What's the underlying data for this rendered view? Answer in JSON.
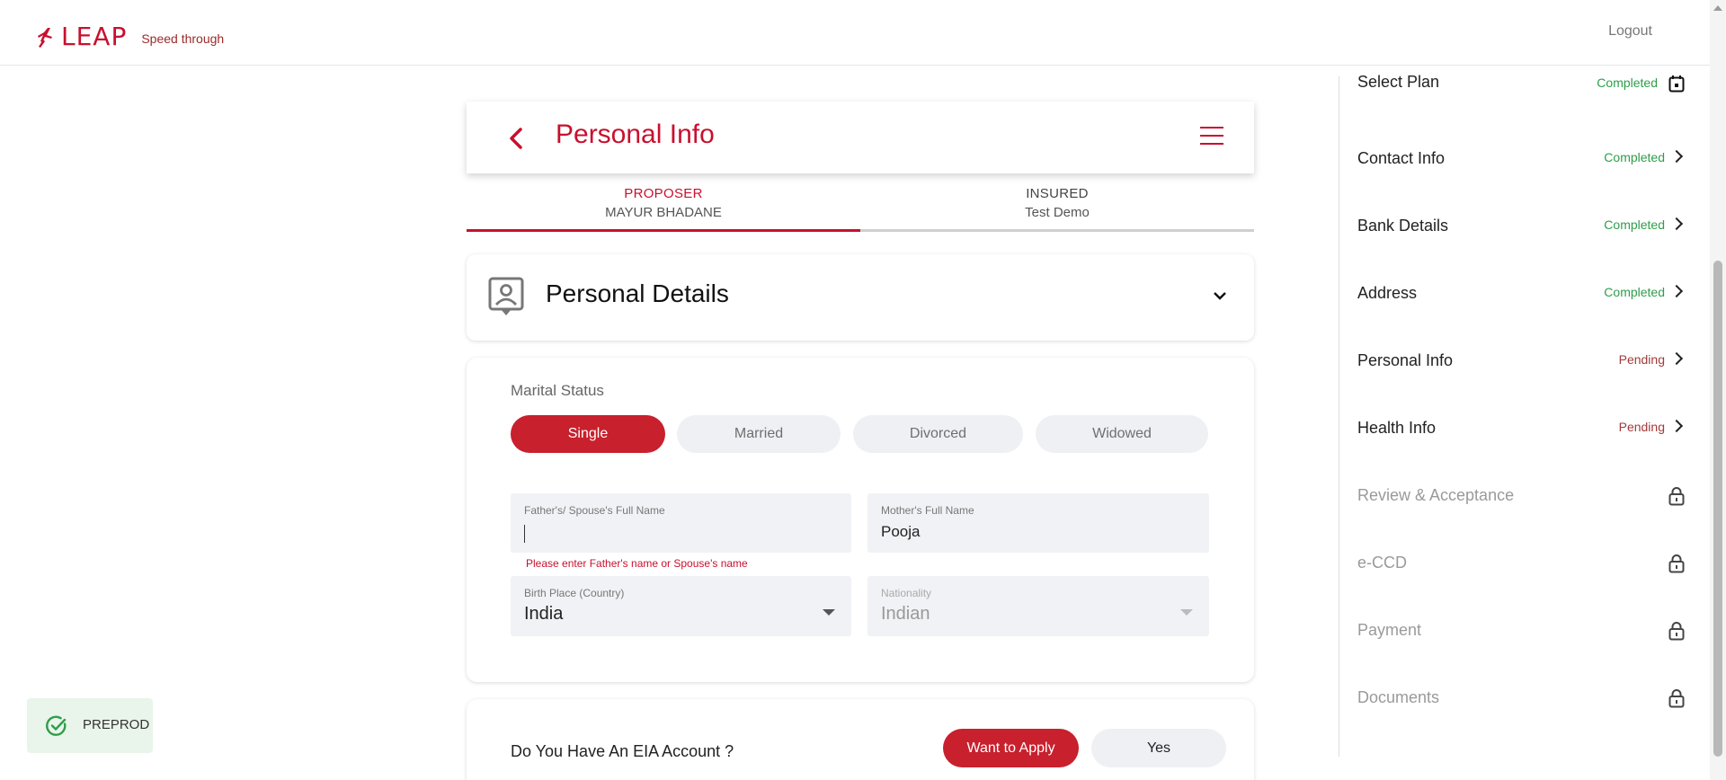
{
  "header": {
    "brand": "LEAP",
    "tagline": "Speed through",
    "logout_label": "Logout"
  },
  "page": {
    "title": "Personal Info"
  },
  "tabs": [
    {
      "role": "PROPOSER",
      "name": "MAYUR BHADANE",
      "active": true
    },
    {
      "role": "INSURED",
      "name": "Test Demo",
      "active": false
    }
  ],
  "section": {
    "title": "Personal Details"
  },
  "form": {
    "marital_status_label": "Marital Status",
    "marital_options": [
      "Single",
      "Married",
      "Divorced",
      "Widowed"
    ],
    "marital_selected": "Single",
    "father_label": "Father's/ Spouse's Full Name",
    "father_value": "",
    "father_error": "Please enter Father's name or Spouse's name",
    "mother_label": "Mother's Full Name",
    "mother_value": "Pooja",
    "birthplace_label": "Birth Place (Country)",
    "birthplace_value": "India",
    "nationality_label": "Nationality",
    "nationality_value": "Indian"
  },
  "eia": {
    "question": "Do You Have An EIA Account ?",
    "apply_label": "Want to Apply",
    "yes_label": "Yes"
  },
  "steps": [
    {
      "name": "Select Plan",
      "status": "Completed",
      "state": "completed",
      "icon": "calendar-icon"
    },
    {
      "name": "Contact Info",
      "status": "Completed",
      "state": "completed",
      "icon": "chevron-right-icon"
    },
    {
      "name": "Bank Details",
      "status": "Completed",
      "state": "completed",
      "icon": "chevron-right-icon"
    },
    {
      "name": "Address",
      "status": "Completed",
      "state": "completed",
      "icon": "chevron-right-icon"
    },
    {
      "name": "Personal Info",
      "status": "Pending",
      "state": "pending",
      "icon": "chevron-right-icon"
    },
    {
      "name": "Health Info",
      "status": "Pending",
      "state": "pending",
      "icon": "chevron-right-icon"
    },
    {
      "name": "Review & Acceptance",
      "status": "",
      "state": "locked",
      "icon": "lock-icon"
    },
    {
      "name": "e-CCD",
      "status": "",
      "state": "locked",
      "icon": "lock-icon"
    },
    {
      "name": "Payment",
      "status": "",
      "state": "locked",
      "icon": "lock-icon"
    },
    {
      "name": "Documents",
      "status": "",
      "state": "locked",
      "icon": "lock-icon"
    }
  ],
  "env_badge": {
    "label": "PREPROD"
  },
  "colors": {
    "brand_red": "#c8102e",
    "completed_green": "#2e9e4a",
    "pending_red": "#a23a3a"
  }
}
